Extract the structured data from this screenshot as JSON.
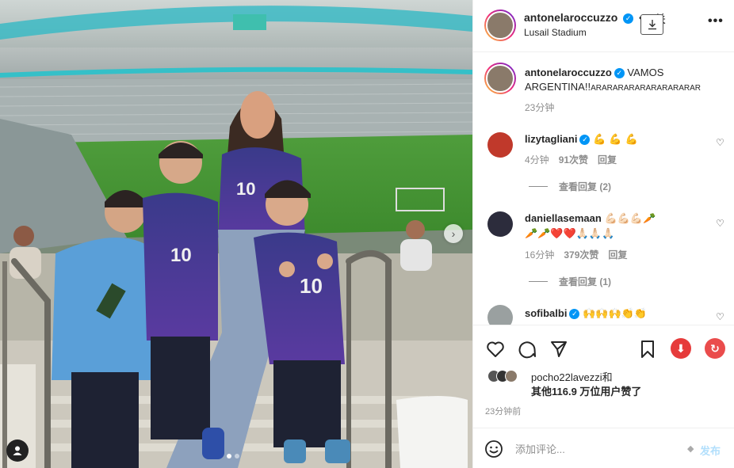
{
  "post": {
    "author": "antonelaroccuzzo",
    "separator": "•",
    "follow_label": "已关",
    "location": "Lusail Stadium",
    "more_label": "•••",
    "caption_user": "antonelaroccuzzo",
    "caption_text": "VAMOS ARGENTINA!!",
    "caption_tail": "ARARARARARARARARARAR",
    "caption_time": "23分钟"
  },
  "comments": [
    {
      "user": "lizytagliani",
      "text": "💪 💪 💪",
      "time": "4分钟",
      "likes": "91次赞",
      "reply": "回复"
    },
    {
      "user": "daniellasemaan",
      "text_line1": "💪🏻💪🏻💪🏻🥕",
      "text_line2": "🥕🥕❤️❤️🙏🏻🙏🏻🙏🏻",
      "time": "16分钟",
      "likes": "379次赞",
      "reply": "回复"
    },
    {
      "user": "sofibalbi",
      "text": "🙌🙌🙌👏👏"
    }
  ],
  "view_replies": [
    {
      "label": "查看回复 (2)"
    },
    {
      "label": "查看回复 (1)"
    }
  ],
  "likes": {
    "first_user": "pocho22lavezzi",
    "connector": "和",
    "others": "其他116.9 万位用户赞了"
  },
  "time_ago": "23分钟前",
  "add_comment": {
    "placeholder": "添加评论...",
    "post_label": "发布"
  },
  "colors": {
    "accent_blue": "#0095f6",
    "border": "#efefef",
    "secondary_text": "#8e8e8e",
    "ext_red": "#e63b3b"
  }
}
